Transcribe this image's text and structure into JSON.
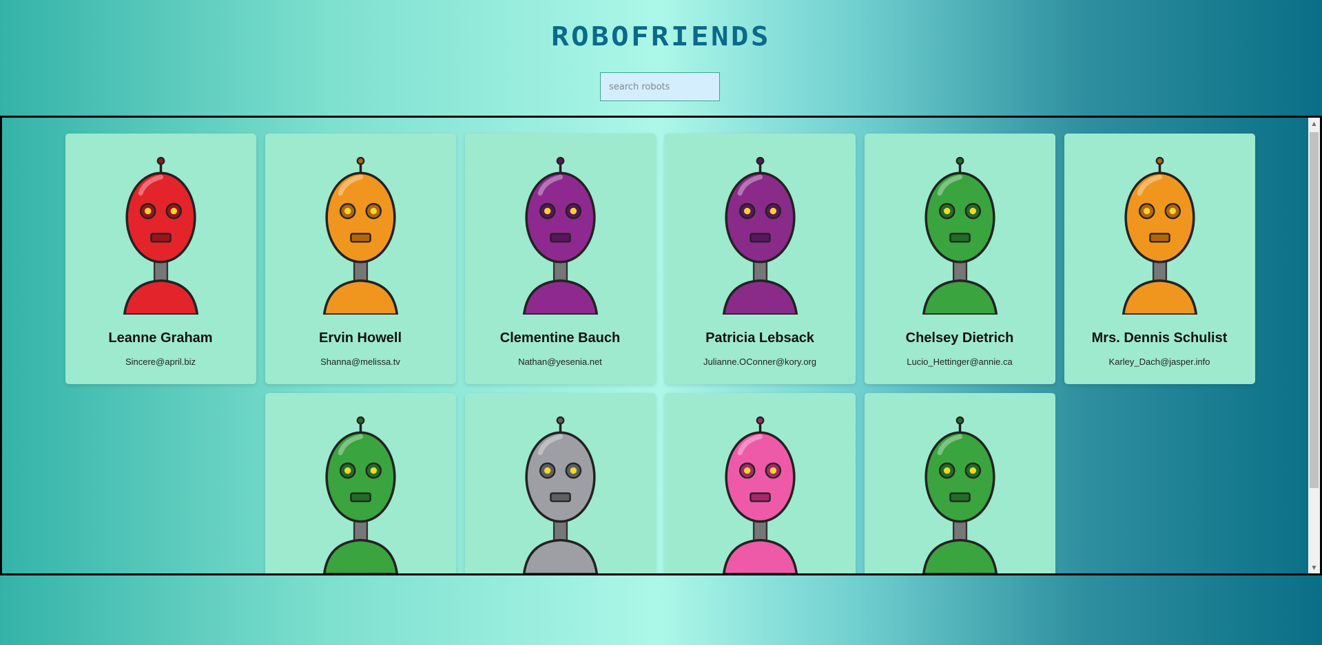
{
  "header": {
    "logo": "ROBOFRIENDS"
  },
  "search": {
    "placeholder": "search robots",
    "value": ""
  },
  "robots": [
    {
      "name": "Leanne Graham",
      "email": "Sincere@april.biz",
      "color": "#e3242b",
      "dark": "#9e1219"
    },
    {
      "name": "Ervin Howell",
      "email": "Shanna@melissa.tv",
      "color": "#f0961f",
      "dark": "#b36509"
    },
    {
      "name": "Clementine Bauch",
      "email": "Nathan@yesenia.net",
      "color": "#8e2a8f",
      "dark": "#5b145e"
    },
    {
      "name": "Patricia Lebsack",
      "email": "Julianne.OConner@kory.org",
      "color": "#8a2b8a",
      "dark": "#5a1560"
    },
    {
      "name": "Chelsey Dietrich",
      "email": "Lucio_Hettinger@annie.ca",
      "color": "#3aa43f",
      "dark": "#1f6e24"
    },
    {
      "name": "Mrs. Dennis Schulist",
      "email": "Karley_Dach@jasper.info",
      "color": "#f0961f",
      "dark": "#b36509"
    },
    {
      "name": "",
      "email": "",
      "color": "#3aa43f",
      "dark": "#1f6e24"
    },
    {
      "name": "",
      "email": "",
      "color": "#9d9fa4",
      "dark": "#5d5f63"
    },
    {
      "name": "",
      "email": "",
      "color": "#ef5aa8",
      "dark": "#a8276b"
    },
    {
      "name": "",
      "email": "",
      "color": "#3aa43f",
      "dark": "#1f6e24"
    }
  ]
}
